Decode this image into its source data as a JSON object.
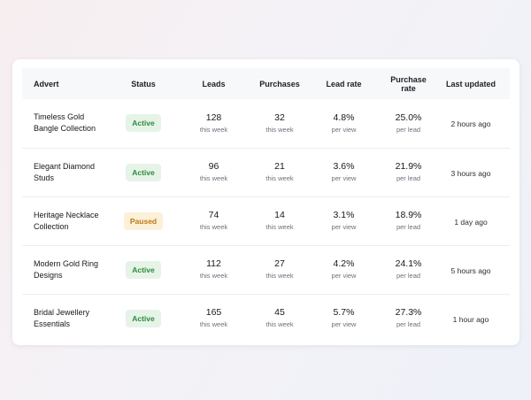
{
  "columns": {
    "advert": "Advert",
    "status": "Status",
    "leads": "Leads",
    "purchases": "Purchases",
    "lead_rate": "Lead rate",
    "purchase_rate": "Purchase rate",
    "last_updated": "Last updated"
  },
  "rows": [
    {
      "advert": "Timeless Gold Bangle Collection",
      "status": "Active",
      "status_type": "active",
      "leads": "128",
      "leads_sub": "this week",
      "purchases": "32",
      "purchases_sub": "this week",
      "lead_rate": "4.8%",
      "lead_rate_sub": "per view",
      "purchase_rate": "25.0%",
      "purchase_rate_sub": "per lead",
      "last_updated": "2 hours ago"
    },
    {
      "advert": "Elegant Diamond Studs",
      "status": "Active",
      "status_type": "active",
      "leads": "96",
      "leads_sub": "this week",
      "purchases": "21",
      "purchases_sub": "this week",
      "lead_rate": "3.6%",
      "lead_rate_sub": "per view",
      "purchase_rate": "21.9%",
      "purchase_rate_sub": "per lead",
      "last_updated": "3 hours ago"
    },
    {
      "advert": "Heritage Necklace Collection",
      "status": "Paused",
      "status_type": "paused",
      "leads": "74",
      "leads_sub": "this week",
      "purchases": "14",
      "purchases_sub": "this week",
      "lead_rate": "3.1%",
      "lead_rate_sub": "per view",
      "purchase_rate": "18.9%",
      "purchase_rate_sub": "per lead",
      "last_updated": "1 day ago"
    },
    {
      "advert": "Modern Gold Ring Designs",
      "status": "Active",
      "status_type": "active",
      "leads": "112",
      "leads_sub": "this week",
      "purchases": "27",
      "purchases_sub": "this week",
      "lead_rate": "4.2%",
      "lead_rate_sub": "per view",
      "purchase_rate": "24.1%",
      "purchase_rate_sub": "per lead",
      "last_updated": "5 hours ago"
    },
    {
      "advert": "Bridal Jewellery Essentials",
      "status": "Active",
      "status_type": "active",
      "leads": "165",
      "leads_sub": "this week",
      "purchases": "45",
      "purchases_sub": "this week",
      "lead_rate": "5.7%",
      "lead_rate_sub": "per view",
      "purchase_rate": "27.3%",
      "purchase_rate_sub": "per lead",
      "last_updated": "1 hour ago"
    }
  ]
}
